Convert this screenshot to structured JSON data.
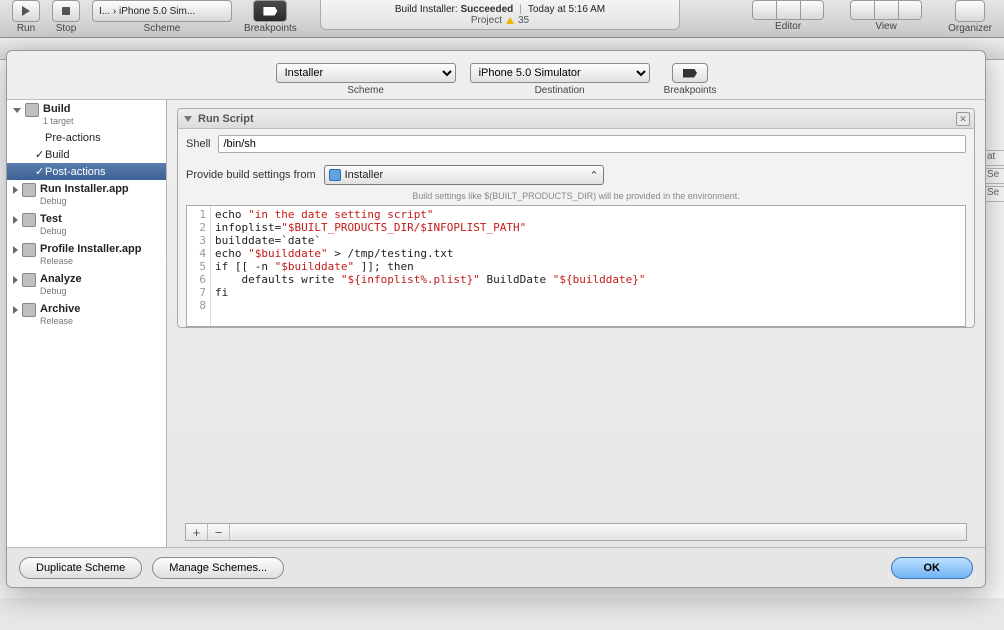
{
  "toolbar": {
    "run": "Run",
    "stop": "Stop",
    "scheme_label": "Scheme",
    "scheme_value": "I... › iPhone 5.0 Sim...",
    "breakpoints": "Breakpoints",
    "editor": "Editor",
    "view": "View",
    "organizer": "Organizer"
  },
  "status": {
    "prefix": "Build Installer: ",
    "result": "Succeeded",
    "time": "Today at 5:16 AM",
    "project_label": "Project",
    "warn_count": "35"
  },
  "sheet": {
    "scheme_label": "Scheme",
    "scheme_value": "Installer",
    "dest_label": "Destination",
    "dest_value": "iPhone 5.0 Simulator",
    "breakpoints_label": "Breakpoints"
  },
  "sidebar": {
    "build": {
      "title": "Build",
      "sub": "1 target"
    },
    "pre": "Pre-actions",
    "buildstep": "Build",
    "post": "Post-actions",
    "run": {
      "title": "Run Installer.app",
      "sub": "Debug"
    },
    "test": {
      "title": "Test",
      "sub": "Debug"
    },
    "profile": {
      "title": "Profile Installer.app",
      "sub": "Release"
    },
    "analyze": {
      "title": "Analyze",
      "sub": "Debug"
    },
    "archive": {
      "title": "Archive",
      "sub": "Release"
    }
  },
  "panel": {
    "title": "Run Script",
    "shell_label": "Shell",
    "shell_value": "/bin/sh",
    "provide_label": "Provide build settings from",
    "provide_value": "Installer",
    "hint": "Build settings like $(BUILT_PRODUCTS_DIR) will be provided in the environment.",
    "script": {
      "l1a": "echo ",
      "l1b": "\"in the date setting script\"",
      "l2a": "infoplist=",
      "l2b": "\"$BUILT_PRODUCTS_DIR/$INFOPLIST_PATH\"",
      "l3": "builddate=`date`",
      "l4a": "echo ",
      "l4b": "\"$builddate\"",
      "l4c": " > /tmp/testing.txt",
      "l5a": "if [[ -n ",
      "l5b": "\"$builddate\"",
      "l5c": " ]]; then",
      "l6a": "    defaults write ",
      "l6b": "\"${infoplist%.plist}\"",
      "l6c": " BuildDate ",
      "l6d": "\"${builddate}\"",
      "l7": "fi"
    },
    "line_numbers": {
      "n1": "1",
      "n2": "2",
      "n3": "3",
      "n4": "4",
      "n5": "5",
      "n6": "6",
      "n7": "7",
      "n8": "8"
    },
    "plus": "+",
    "minus": "−"
  },
  "footer": {
    "duplicate": "Duplicate Scheme",
    "manage": "Manage Schemes...",
    "ok": "OK"
  },
  "peek": {
    "a": "at",
    "b": "Se",
    "c": "Se"
  }
}
